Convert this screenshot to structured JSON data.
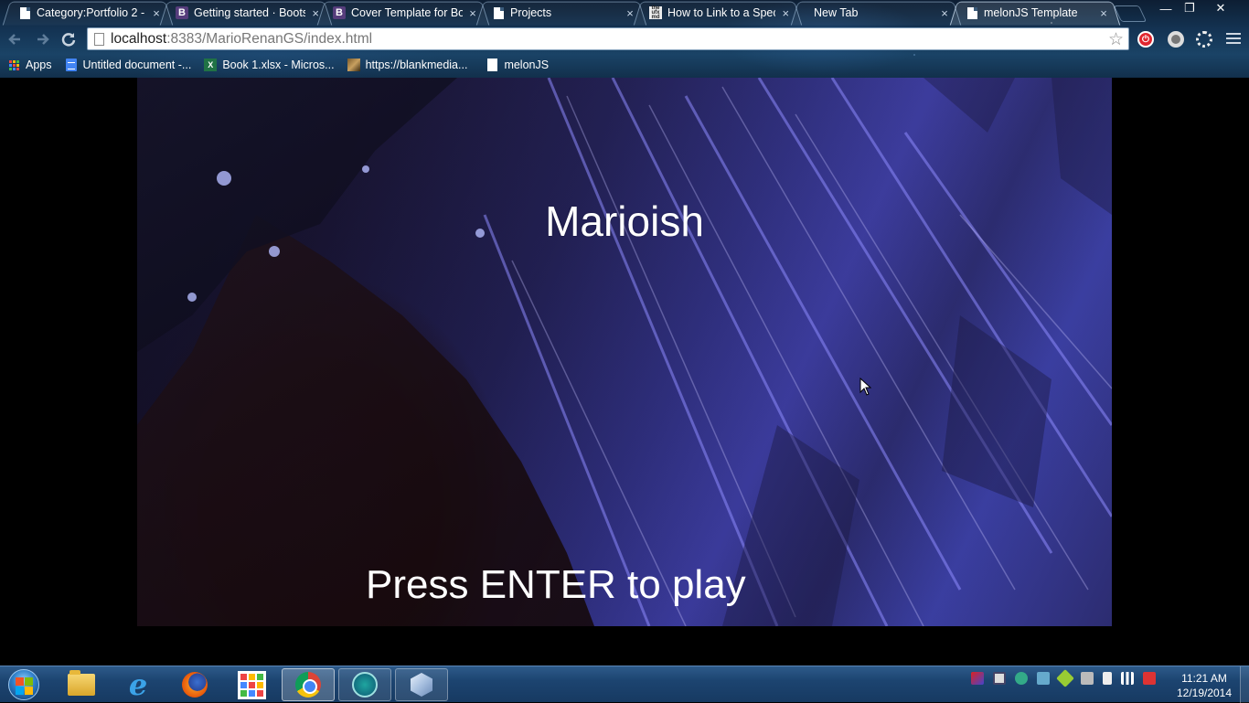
{
  "browser": {
    "tabs": [
      {
        "title": "Category:Portfolio 2 -",
        "icon": "page-icon",
        "active": false
      },
      {
        "title": "Getting started · Boots",
        "icon": "bootstrap-icon",
        "active": false
      },
      {
        "title": "Cover Template for Bo",
        "icon": "bootstrap-icon",
        "active": false
      },
      {
        "title": "Projects",
        "icon": "page-icon",
        "active": false
      },
      {
        "title": "How to Link to a Speci",
        "icon": "site-icon",
        "active": false
      },
      {
        "title": "New Tab",
        "icon": "none",
        "active": false
      },
      {
        "title": "melonJS Template",
        "icon": "page-icon",
        "active": true
      }
    ],
    "tab_close_glyph": "×",
    "window_controls": {
      "minimize": "—",
      "restore": "❐",
      "close": "✕"
    },
    "url": {
      "host": "localhost",
      "rest": ":8383/MarioRenanGS/index.html"
    },
    "star": "☆",
    "bookmarks": [
      {
        "label": "Apps",
        "icon": "apps-grid-icon"
      },
      {
        "label": "Untitled document -...",
        "icon": "google-docs-icon"
      },
      {
        "label": "Book 1.xlsx - Micros...",
        "icon": "excel-icon"
      },
      {
        "label": "https://blankmedia...",
        "icon": "image-icon"
      },
      {
        "label": "melonJS",
        "icon": "page-icon"
      }
    ]
  },
  "game": {
    "title": "Marioish",
    "prompt": "Press ENTER to play"
  },
  "taskbar": {
    "pinned": [
      "windows-explorer",
      "internet-explorer",
      "firefox",
      "apps-launcher",
      "chrome",
      "sketchup-viewer",
      "virtual-machine"
    ],
    "clock_time": "11:21 AM",
    "clock_date": "12/19/2014"
  },
  "colors": {
    "accent_blue": "#1c4470",
    "rock_blue": "#3a3a9a"
  }
}
